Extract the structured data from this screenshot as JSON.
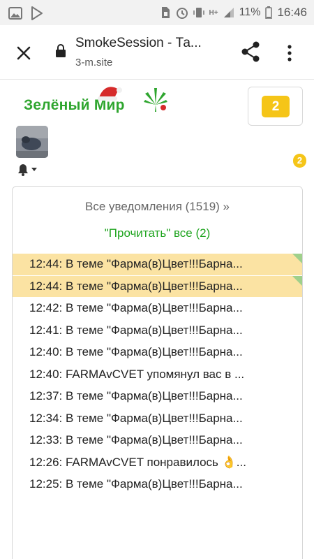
{
  "status_bar": {
    "battery": "11%",
    "time": "16:46",
    "network": "H+"
  },
  "browser": {
    "title": "SmokeSession - Та...",
    "url": "3-m.site"
  },
  "header": {
    "logo_text": "Зелёный Мир",
    "message_count": "2",
    "notification_count": "2"
  },
  "notifications": {
    "all_link": "Все уведомления (1519) »",
    "read_all_link": "\"Прочитать\" все (2)",
    "items": [
      {
        "text": "12:44: В теме \"Фарма(в)Цвет!!!Барна...",
        "unread": true
      },
      {
        "text": "12:44: В теме \"Фарма(в)Цвет!!!Барна...",
        "unread": true
      },
      {
        "text": "12:42: В теме \"Фарма(в)Цвет!!!Барна...",
        "unread": false
      },
      {
        "text": "12:41: В теме \"Фарма(в)Цвет!!!Барна...",
        "unread": false
      },
      {
        "text": "12:40: В теме \"Фарма(в)Цвет!!!Барна...",
        "unread": false
      },
      {
        "text": "12:40: FARMAvCVET упомянул вас в ...",
        "unread": false
      },
      {
        "text": "12:37: В теме \"Фарма(в)Цвет!!!Барна...",
        "unread": false
      },
      {
        "text": "12:34: В теме \"Фарма(в)Цвет!!!Барна...",
        "unread": false
      },
      {
        "text": "12:33: В теме \"Фарма(в)Цвет!!!Барна...",
        "unread": false
      },
      {
        "text": "12:26: FARMAvCVET понравилось 👌...",
        "unread": false
      },
      {
        "text": "12:25: В теме \"Фарма(в)Цвет!!!Барна...",
        "unread": false
      }
    ]
  },
  "colors": {
    "unread_bg": "#fbe3a3",
    "badge": "#f5c518",
    "accent_green": "#1ea41e"
  }
}
